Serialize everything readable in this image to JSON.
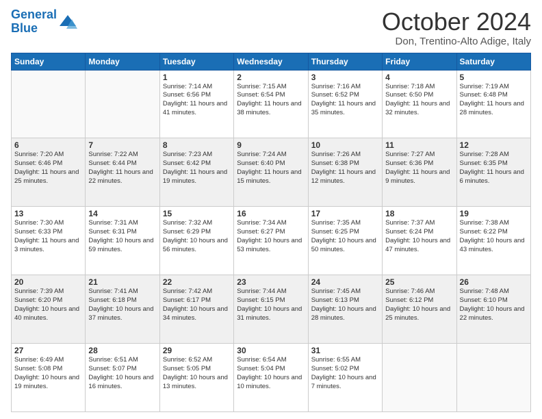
{
  "header": {
    "logo_line1": "General",
    "logo_line2": "Blue",
    "month": "October 2024",
    "location": "Don, Trentino-Alto Adige, Italy"
  },
  "weekdays": [
    "Sunday",
    "Monday",
    "Tuesday",
    "Wednesday",
    "Thursday",
    "Friday",
    "Saturday"
  ],
  "weeks": [
    [
      {
        "day": "",
        "info": ""
      },
      {
        "day": "",
        "info": ""
      },
      {
        "day": "1",
        "info": "Sunrise: 7:14 AM\nSunset: 6:56 PM\nDaylight: 11 hours and 41 minutes."
      },
      {
        "day": "2",
        "info": "Sunrise: 7:15 AM\nSunset: 6:54 PM\nDaylight: 11 hours and 38 minutes."
      },
      {
        "day": "3",
        "info": "Sunrise: 7:16 AM\nSunset: 6:52 PM\nDaylight: 11 hours and 35 minutes."
      },
      {
        "day": "4",
        "info": "Sunrise: 7:18 AM\nSunset: 6:50 PM\nDaylight: 11 hours and 32 minutes."
      },
      {
        "day": "5",
        "info": "Sunrise: 7:19 AM\nSunset: 6:48 PM\nDaylight: 11 hours and 28 minutes."
      }
    ],
    [
      {
        "day": "6",
        "info": "Sunrise: 7:20 AM\nSunset: 6:46 PM\nDaylight: 11 hours and 25 minutes."
      },
      {
        "day": "7",
        "info": "Sunrise: 7:22 AM\nSunset: 6:44 PM\nDaylight: 11 hours and 22 minutes."
      },
      {
        "day": "8",
        "info": "Sunrise: 7:23 AM\nSunset: 6:42 PM\nDaylight: 11 hours and 19 minutes."
      },
      {
        "day": "9",
        "info": "Sunrise: 7:24 AM\nSunset: 6:40 PM\nDaylight: 11 hours and 15 minutes."
      },
      {
        "day": "10",
        "info": "Sunrise: 7:26 AM\nSunset: 6:38 PM\nDaylight: 11 hours and 12 minutes."
      },
      {
        "day": "11",
        "info": "Sunrise: 7:27 AM\nSunset: 6:36 PM\nDaylight: 11 hours and 9 minutes."
      },
      {
        "day": "12",
        "info": "Sunrise: 7:28 AM\nSunset: 6:35 PM\nDaylight: 11 hours and 6 minutes."
      }
    ],
    [
      {
        "day": "13",
        "info": "Sunrise: 7:30 AM\nSunset: 6:33 PM\nDaylight: 11 hours and 3 minutes."
      },
      {
        "day": "14",
        "info": "Sunrise: 7:31 AM\nSunset: 6:31 PM\nDaylight: 10 hours and 59 minutes."
      },
      {
        "day": "15",
        "info": "Sunrise: 7:32 AM\nSunset: 6:29 PM\nDaylight: 10 hours and 56 minutes."
      },
      {
        "day": "16",
        "info": "Sunrise: 7:34 AM\nSunset: 6:27 PM\nDaylight: 10 hours and 53 minutes."
      },
      {
        "day": "17",
        "info": "Sunrise: 7:35 AM\nSunset: 6:25 PM\nDaylight: 10 hours and 50 minutes."
      },
      {
        "day": "18",
        "info": "Sunrise: 7:37 AM\nSunset: 6:24 PM\nDaylight: 10 hours and 47 minutes."
      },
      {
        "day": "19",
        "info": "Sunrise: 7:38 AM\nSunset: 6:22 PM\nDaylight: 10 hours and 43 minutes."
      }
    ],
    [
      {
        "day": "20",
        "info": "Sunrise: 7:39 AM\nSunset: 6:20 PM\nDaylight: 10 hours and 40 minutes."
      },
      {
        "day": "21",
        "info": "Sunrise: 7:41 AM\nSunset: 6:18 PM\nDaylight: 10 hours and 37 minutes."
      },
      {
        "day": "22",
        "info": "Sunrise: 7:42 AM\nSunset: 6:17 PM\nDaylight: 10 hours and 34 minutes."
      },
      {
        "day": "23",
        "info": "Sunrise: 7:44 AM\nSunset: 6:15 PM\nDaylight: 10 hours and 31 minutes."
      },
      {
        "day": "24",
        "info": "Sunrise: 7:45 AM\nSunset: 6:13 PM\nDaylight: 10 hours and 28 minutes."
      },
      {
        "day": "25",
        "info": "Sunrise: 7:46 AM\nSunset: 6:12 PM\nDaylight: 10 hours and 25 minutes."
      },
      {
        "day": "26",
        "info": "Sunrise: 7:48 AM\nSunset: 6:10 PM\nDaylight: 10 hours and 22 minutes."
      }
    ],
    [
      {
        "day": "27",
        "info": "Sunrise: 6:49 AM\nSunset: 5:08 PM\nDaylight: 10 hours and 19 minutes."
      },
      {
        "day": "28",
        "info": "Sunrise: 6:51 AM\nSunset: 5:07 PM\nDaylight: 10 hours and 16 minutes."
      },
      {
        "day": "29",
        "info": "Sunrise: 6:52 AM\nSunset: 5:05 PM\nDaylight: 10 hours and 13 minutes."
      },
      {
        "day": "30",
        "info": "Sunrise: 6:54 AM\nSunset: 5:04 PM\nDaylight: 10 hours and 10 minutes."
      },
      {
        "day": "31",
        "info": "Sunrise: 6:55 AM\nSunset: 5:02 PM\nDaylight: 10 hours and 7 minutes."
      },
      {
        "day": "",
        "info": ""
      },
      {
        "day": "",
        "info": ""
      }
    ]
  ]
}
